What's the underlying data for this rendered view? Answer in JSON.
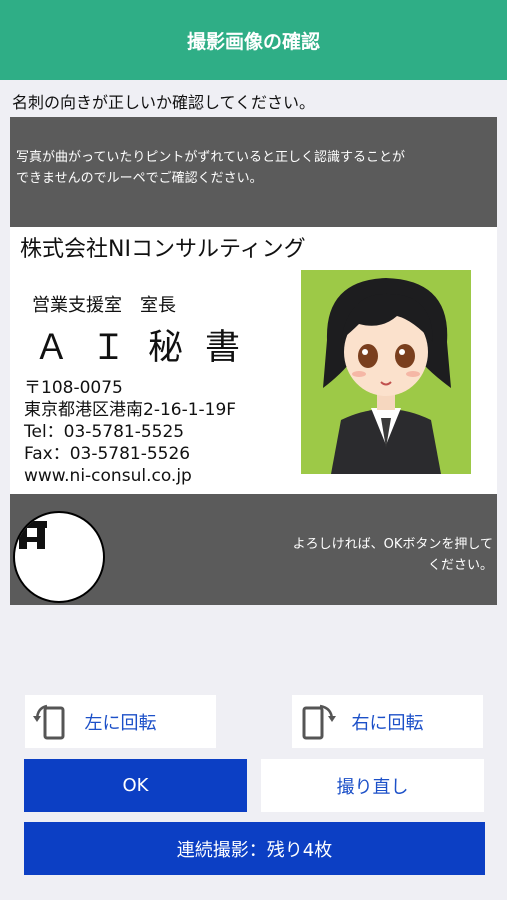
{
  "header": {
    "title": "撮影画像の確認"
  },
  "instruction": "名刺の向きが正しいか確認してください。",
  "preview": {
    "warning_line1": "写真が曲がっていたりピントがずれていると正しく認識することが",
    "warning_line2": "できませんのでルーペでご確認ください。",
    "confirm_line1": "よろしければ、OKボタンを押して",
    "confirm_line2": "ください。",
    "card": {
      "company": "株式会社NIコンサルティング",
      "department": "営業支援室　室長",
      "name": "ＡＩ秘書",
      "postal": "〒108-0075",
      "address": "東京都港区港南2-16-1-19F",
      "tel": "Tel：03-5781-5525",
      "fax": "Fax：03-5781-5526",
      "web": "www.ni-consul.co.jp"
    }
  },
  "buttons": {
    "rotate_left": "左に回転",
    "rotate_right": "右に回転",
    "ok": "OK",
    "retake": "撮り直し",
    "continuous": "連続撮影：残り4枚"
  },
  "colors": {
    "header": "#2fae86",
    "primary": "#0c3fc4",
    "link": "#1c50c8",
    "overlay": "#5b5b5b",
    "avatar_bg": "#9dc947"
  }
}
